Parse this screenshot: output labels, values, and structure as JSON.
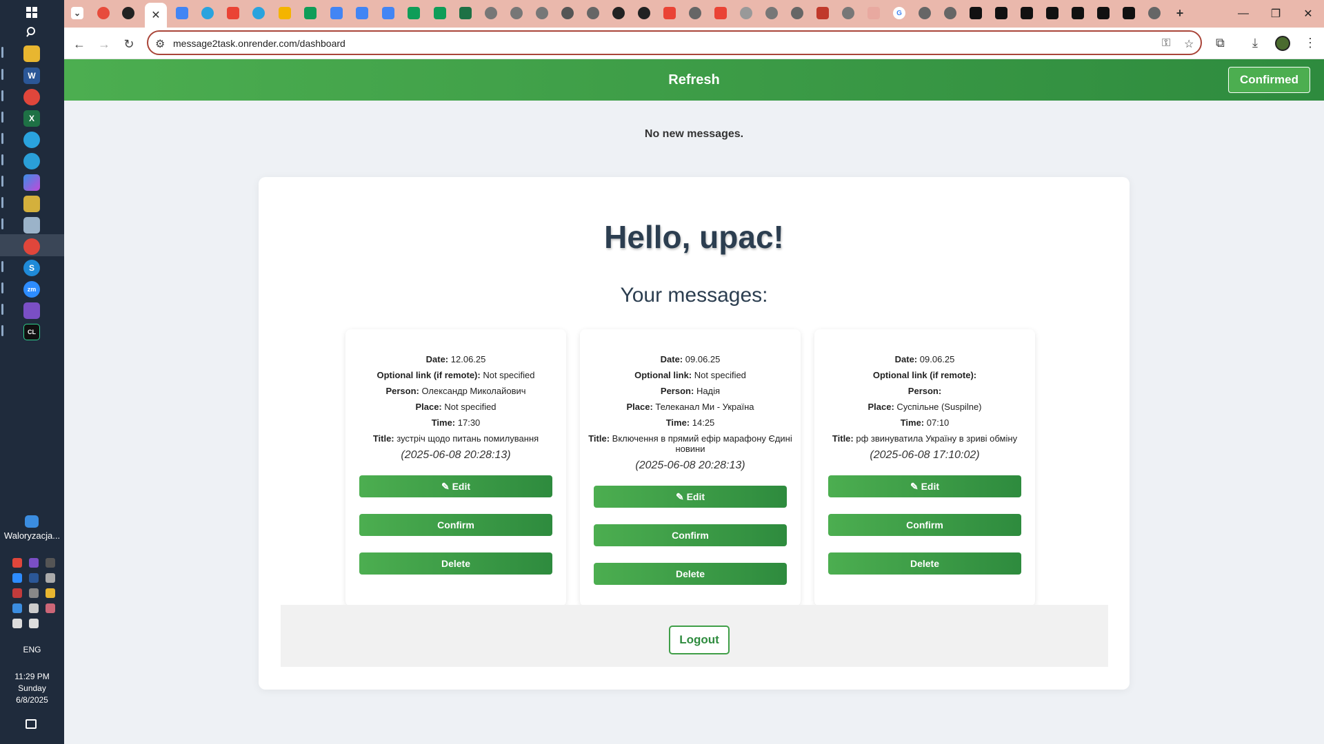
{
  "taskbar": {
    "widget_label": "Waloryzacja...",
    "language": "ENG",
    "clock": {
      "time": "11:29 PM",
      "day": "Sunday",
      "date": "6/8/2025"
    },
    "pinned_icons": [
      "windows-start-icon",
      "search-icon",
      "file-explorer-icon",
      "word-icon",
      "chrome-icon",
      "excel-icon",
      "telegram-icon",
      "edge-icon",
      "copilot-icon",
      "notepad-icon",
      "clipboard-icon",
      "chrome-active-icon",
      "skype-icon",
      "zoom-icon",
      "visual-studio-icon",
      "clion-icon"
    ]
  },
  "browser": {
    "url": "message2task.onrender.com/dashboard",
    "active_tab_close": "✕",
    "new_tab": "+"
  },
  "page": {
    "refresh_label": "Refresh",
    "confirmed_label": "Confirmed",
    "status": "No new messages.",
    "greeting": "Hello, upac!",
    "subheading": "Your messages:",
    "labels": {
      "date": "Date:",
      "link": "Optional link (if remote):",
      "person": "Person:",
      "place": "Place:",
      "time": "Time:",
      "title": "Title:"
    },
    "buttons": {
      "edit": "Edit",
      "confirm": "Confirm",
      "delete": "Delete"
    },
    "messages": [
      {
        "date": "12.06.25",
        "link": "Not specified",
        "person": "Олександр Миколайович",
        "place": "Not specified",
        "time": "17:30",
        "title": "зустріч щодо питань помилування",
        "stamp": "(2025-06-08 20:28:13)"
      },
      {
        "date": "09.06.25",
        "link": "Not specified",
        "person": "Надія",
        "place": "Телеканал Ми - Україна",
        "time": "14:25",
        "title": "Включення в прямий ефір марафону Єдині новини",
        "stamp": "(2025-06-08 20:28:13)"
      },
      {
        "date": "09.06.25",
        "link": "",
        "person": "",
        "place": "Суспільне (Suspilne)",
        "time": "07:10",
        "title": "рф звинуватила Україну в зриві обміну",
        "stamp": "(2025-06-08 17:10:02)"
      }
    ],
    "logout_label": "Logout"
  },
  "colors": {
    "accent_green": "#4cae50",
    "accent_green_dark": "#2e8b3e",
    "tabstrip": "#eab8ac",
    "taskbar": "#1f2b3c",
    "heading": "#2c3e50"
  }
}
